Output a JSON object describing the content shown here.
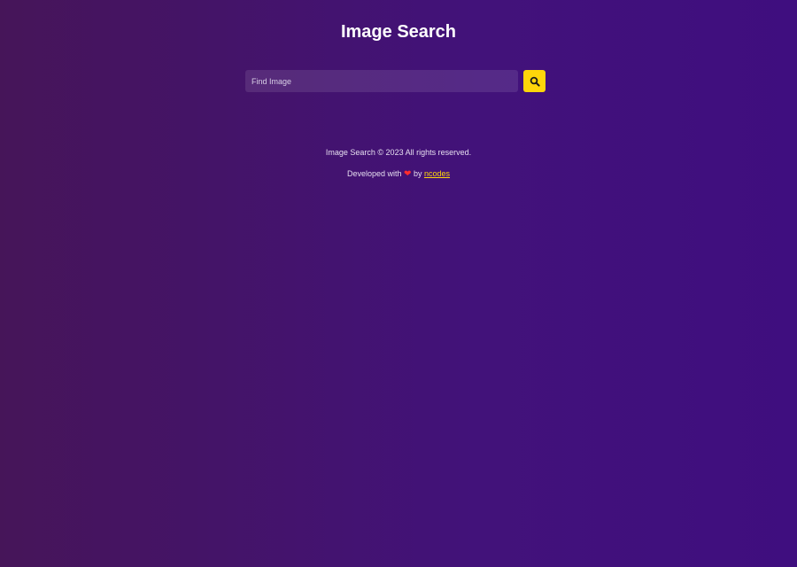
{
  "header": {
    "title": "Image Search"
  },
  "search": {
    "placeholder": "Find Image",
    "value": "",
    "button_icon": "search-icon"
  },
  "footer": {
    "copyright": "Image Search © 2023 All rights reserved.",
    "credit_prefix": "Developed with",
    "heart_symbol": "❤",
    "credit_by": "by",
    "author_link": "ncodes"
  },
  "colors": {
    "accent": "#ffd60a",
    "heart": "#ff2d2d",
    "background_start": "#461559",
    "background_end": "#3f0e7f"
  }
}
